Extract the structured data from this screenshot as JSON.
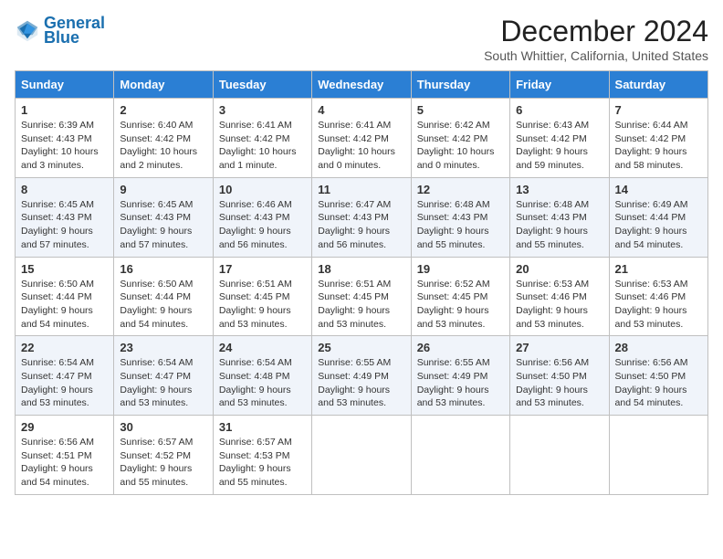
{
  "header": {
    "logo_line1": "General",
    "logo_line2": "Blue",
    "title": "December 2024",
    "subtitle": "South Whittier, California, United States"
  },
  "calendar": {
    "days_of_week": [
      "Sunday",
      "Monday",
      "Tuesday",
      "Wednesday",
      "Thursday",
      "Friday",
      "Saturday"
    ],
    "weeks": [
      [
        {
          "day": "1",
          "sunrise": "6:39 AM",
          "sunset": "4:43 PM",
          "daylight": "10 hours and 3 minutes."
        },
        {
          "day": "2",
          "sunrise": "6:40 AM",
          "sunset": "4:42 PM",
          "daylight": "10 hours and 2 minutes."
        },
        {
          "day": "3",
          "sunrise": "6:41 AM",
          "sunset": "4:42 PM",
          "daylight": "10 hours and 1 minute."
        },
        {
          "day": "4",
          "sunrise": "6:41 AM",
          "sunset": "4:42 PM",
          "daylight": "10 hours and 0 minutes."
        },
        {
          "day": "5",
          "sunrise": "6:42 AM",
          "sunset": "4:42 PM",
          "daylight": "10 hours and 0 minutes."
        },
        {
          "day": "6",
          "sunrise": "6:43 AM",
          "sunset": "4:42 PM",
          "daylight": "9 hours and 59 minutes."
        },
        {
          "day": "7",
          "sunrise": "6:44 AM",
          "sunset": "4:42 PM",
          "daylight": "9 hours and 58 minutes."
        }
      ],
      [
        {
          "day": "8",
          "sunrise": "6:45 AM",
          "sunset": "4:43 PM",
          "daylight": "9 hours and 57 minutes."
        },
        {
          "day": "9",
          "sunrise": "6:45 AM",
          "sunset": "4:43 PM",
          "daylight": "9 hours and 57 minutes."
        },
        {
          "day": "10",
          "sunrise": "6:46 AM",
          "sunset": "4:43 PM",
          "daylight": "9 hours and 56 minutes."
        },
        {
          "day": "11",
          "sunrise": "6:47 AM",
          "sunset": "4:43 PM",
          "daylight": "9 hours and 56 minutes."
        },
        {
          "day": "12",
          "sunrise": "6:48 AM",
          "sunset": "4:43 PM",
          "daylight": "9 hours and 55 minutes."
        },
        {
          "day": "13",
          "sunrise": "6:48 AM",
          "sunset": "4:43 PM",
          "daylight": "9 hours and 55 minutes."
        },
        {
          "day": "14",
          "sunrise": "6:49 AM",
          "sunset": "4:44 PM",
          "daylight": "9 hours and 54 minutes."
        }
      ],
      [
        {
          "day": "15",
          "sunrise": "6:50 AM",
          "sunset": "4:44 PM",
          "daylight": "9 hours and 54 minutes."
        },
        {
          "day": "16",
          "sunrise": "6:50 AM",
          "sunset": "4:44 PM",
          "daylight": "9 hours and 54 minutes."
        },
        {
          "day": "17",
          "sunrise": "6:51 AM",
          "sunset": "4:45 PM",
          "daylight": "9 hours and 53 minutes."
        },
        {
          "day": "18",
          "sunrise": "6:51 AM",
          "sunset": "4:45 PM",
          "daylight": "9 hours and 53 minutes."
        },
        {
          "day": "19",
          "sunrise": "6:52 AM",
          "sunset": "4:45 PM",
          "daylight": "9 hours and 53 minutes."
        },
        {
          "day": "20",
          "sunrise": "6:53 AM",
          "sunset": "4:46 PM",
          "daylight": "9 hours and 53 minutes."
        },
        {
          "day": "21",
          "sunrise": "6:53 AM",
          "sunset": "4:46 PM",
          "daylight": "9 hours and 53 minutes."
        }
      ],
      [
        {
          "day": "22",
          "sunrise": "6:54 AM",
          "sunset": "4:47 PM",
          "daylight": "9 hours and 53 minutes."
        },
        {
          "day": "23",
          "sunrise": "6:54 AM",
          "sunset": "4:47 PM",
          "daylight": "9 hours and 53 minutes."
        },
        {
          "day": "24",
          "sunrise": "6:54 AM",
          "sunset": "4:48 PM",
          "daylight": "9 hours and 53 minutes."
        },
        {
          "day": "25",
          "sunrise": "6:55 AM",
          "sunset": "4:49 PM",
          "daylight": "9 hours and 53 minutes."
        },
        {
          "day": "26",
          "sunrise": "6:55 AM",
          "sunset": "4:49 PM",
          "daylight": "9 hours and 53 minutes."
        },
        {
          "day": "27",
          "sunrise": "6:56 AM",
          "sunset": "4:50 PM",
          "daylight": "9 hours and 53 minutes."
        },
        {
          "day": "28",
          "sunrise": "6:56 AM",
          "sunset": "4:50 PM",
          "daylight": "9 hours and 54 minutes."
        }
      ],
      [
        {
          "day": "29",
          "sunrise": "6:56 AM",
          "sunset": "4:51 PM",
          "daylight": "9 hours and 54 minutes."
        },
        {
          "day": "30",
          "sunrise": "6:57 AM",
          "sunset": "4:52 PM",
          "daylight": "9 hours and 55 minutes."
        },
        {
          "day": "31",
          "sunrise": "6:57 AM",
          "sunset": "4:53 PM",
          "daylight": "9 hours and 55 minutes."
        },
        null,
        null,
        null,
        null
      ]
    ]
  }
}
